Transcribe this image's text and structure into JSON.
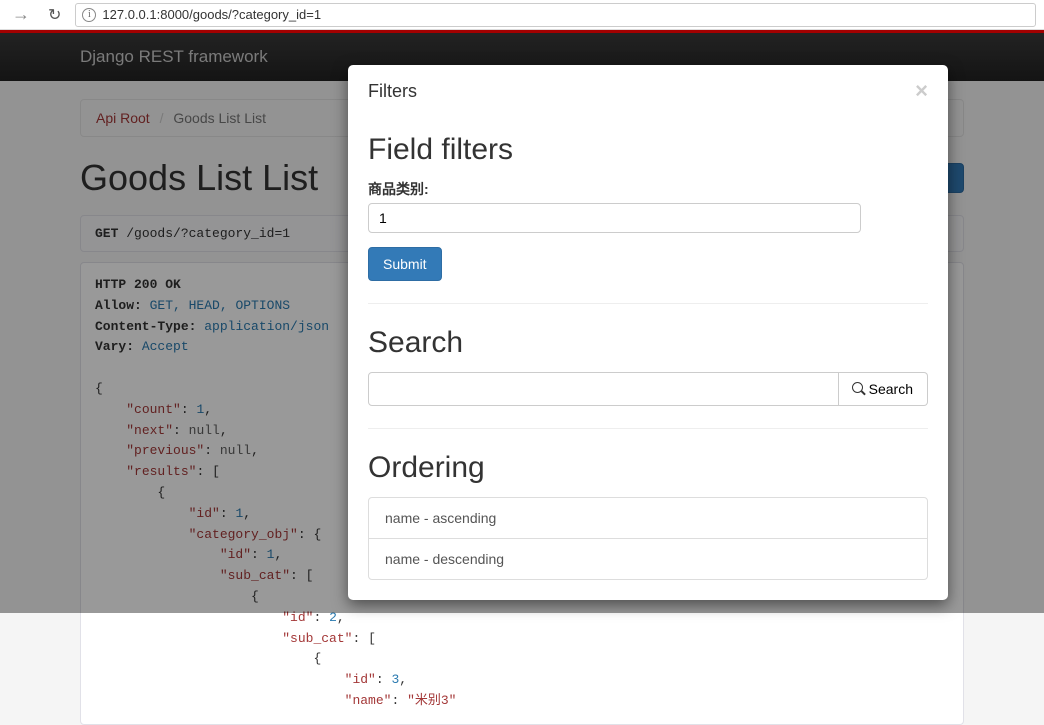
{
  "browser": {
    "url": "127.0.0.1:8000/goods/?category_id=1"
  },
  "navbar": {
    "brand": "Django REST framework"
  },
  "breadcrumb": {
    "root": "Api Root",
    "current": "Goods List List"
  },
  "page": {
    "title": "Goods List List",
    "filters_btn": "Filters"
  },
  "request": {
    "method": "GET",
    "path": "/goods/?category_id=1"
  },
  "response": {
    "status": "HTTP 200 OK",
    "headers": {
      "allow_key": "Allow:",
      "allow_val": "GET, HEAD, OPTIONS",
      "ctype_key": "Content-Type:",
      "ctype_val": "application/json",
      "vary_key": "Vary:",
      "vary_val": "Accept"
    },
    "body": {
      "count": 1,
      "next": "null",
      "previous": "null",
      "results_id": 1,
      "cat_id": 1,
      "sub_id": 2,
      "sub2_id": 3,
      "sub2_name": "\"米别3\""
    }
  },
  "modal": {
    "title": "Filters",
    "field_filters_heading": "Field filters",
    "category_label": "商品类别:",
    "category_value": "1",
    "submit": "Submit",
    "search_heading": "Search",
    "search_btn": "Search",
    "ordering_heading": "Ordering",
    "ordering_options": {
      "asc": "name - ascending",
      "desc": "name - descending"
    }
  }
}
